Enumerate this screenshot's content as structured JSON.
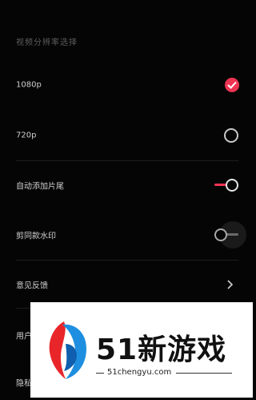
{
  "settings": {
    "section_title": "视频分辨率选择",
    "items": [
      {
        "label": "1080p",
        "control": "check",
        "selected": true
      },
      {
        "label": "720p",
        "control": "radio",
        "selected": false
      },
      {
        "label": "自动添加片尾",
        "control": "toggle",
        "on": true
      },
      {
        "label": "剪同款水印",
        "control": "toggle",
        "on": false
      },
      {
        "label": "意见反馈",
        "control": "chevron"
      },
      {
        "label": "用户",
        "control": "chevron"
      },
      {
        "label": "隐私",
        "control": "chevron"
      }
    ]
  },
  "watermark": {
    "brand": "51新游戏",
    "url": "51chengyu.com"
  },
  "colors": {
    "accent": "#ef3453",
    "background": "#050505"
  }
}
